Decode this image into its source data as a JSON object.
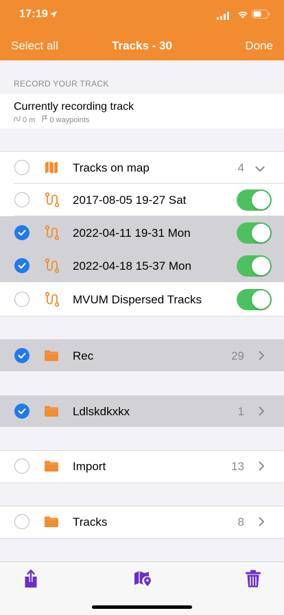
{
  "status_bar": {
    "time": "17:19"
  },
  "nav": {
    "left": "Select all",
    "title": "Tracks - 30",
    "right": "Done"
  },
  "record_section": {
    "header": "RECORD YOUR TRACK",
    "title": "Currently recording track",
    "distance": "0 m",
    "waypoints": "0 waypoints"
  },
  "tracks": [
    {
      "label": "Tracks on map",
      "count": "4",
      "selected": false,
      "icon": "map-icon",
      "accessory": "chevron-down"
    },
    {
      "label": "2017-08-05 19-27 Sat",
      "selected": false,
      "icon": "route-icon",
      "accessory": "toggle",
      "toggle": true
    },
    {
      "label": "2022-04-11 19-31 Mon",
      "selected": true,
      "icon": "route-icon",
      "accessory": "toggle",
      "toggle": true
    },
    {
      "label": "2022-04-18 15-37 Mon",
      "selected": true,
      "icon": "route-icon",
      "accessory": "toggle",
      "toggle": true
    },
    {
      "label": "MVUM Dispersed Tracks",
      "selected": false,
      "icon": "route-icon",
      "accessory": "toggle",
      "toggle": true
    }
  ],
  "folders": [
    {
      "label": "Rec",
      "count": "29",
      "selected": true,
      "icon": "folder-icon"
    },
    {
      "label": "Ldlskdkxkx",
      "count": "1",
      "selected": true,
      "icon": "folder-icon"
    },
    {
      "label": "Import",
      "count": "13",
      "selected": false,
      "icon": "folder-icon"
    },
    {
      "label": "Tracks",
      "count": "8",
      "selected": false,
      "icon": "folder-icon"
    }
  ],
  "toolbar": {
    "items": [
      "share-icon",
      "map-pin-icon",
      "trash-icon"
    ]
  },
  "colors": {
    "accent": "#f28c30",
    "selection": "#d1d1d6",
    "checkbox": "#1f7aec",
    "toggle": "#4cc25e",
    "toolbar_icon": "#6a2fc9"
  }
}
